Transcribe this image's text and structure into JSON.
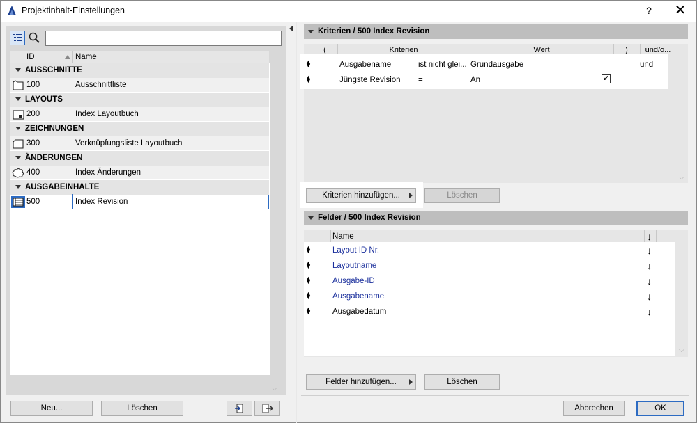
{
  "window": {
    "title": "Projektinhalt-Einstellungen",
    "help_label": "?",
    "close_label": "✕"
  },
  "left": {
    "search_placeholder": "",
    "search_value": "",
    "columns": {
      "id": "ID",
      "name": "Name"
    },
    "groups": [
      {
        "label": "AUSSCHNITTE",
        "items": [
          {
            "id": "100",
            "name": "Ausschnittliste",
            "icon": "view-list-icon"
          }
        ]
      },
      {
        "label": "LAYOUTS",
        "items": [
          {
            "id": "200",
            "name": "Index Layoutbuch",
            "icon": "layout-book-icon"
          }
        ]
      },
      {
        "label": "ZEICHNUNGEN",
        "items": [
          {
            "id": "300",
            "name": "Verknüpfungsliste Layoutbuch",
            "icon": "drawing-icon"
          }
        ]
      },
      {
        "label": "ÄNDERUNGEN",
        "items": [
          {
            "id": "400",
            "name": "Index Änderungen",
            "icon": "cloud-change-icon"
          }
        ]
      },
      {
        "label": "AUSGABEINHALTE",
        "items": [
          {
            "id": "500",
            "name": "Index Revision",
            "icon": "issue-content-icon",
            "selected": true
          }
        ]
      }
    ],
    "buttons": {
      "new": "Neu...",
      "delete": "Löschen"
    }
  },
  "criteria": {
    "title": "Kriterien / 500 Index Revision",
    "columns": {
      "open": "(",
      "criteria": "Kriterien",
      "value": "Wert",
      "close": ")",
      "andor": "und/o..."
    },
    "rows": [
      {
        "criterion": "Ausgabename",
        "operator": "ist nicht glei...",
        "value": "Grundausgabe",
        "andor": "und",
        "checked": false
      },
      {
        "criterion": "Jüngste Revision",
        "operator": "=",
        "value": "An",
        "andor": "",
        "checked": true
      }
    ],
    "add_button": "Kriterien hinzufügen...",
    "delete_button": "Löschen"
  },
  "fields": {
    "title": "Felder / 500 Index Revision",
    "column_name": "Name",
    "rows": [
      {
        "name": "Layout ID Nr.",
        "linked": true
      },
      {
        "name": "Layoutname",
        "linked": true
      },
      {
        "name": "Ausgabe-ID",
        "linked": true
      },
      {
        "name": "Ausgabename",
        "linked": true
      },
      {
        "name": "Ausgabedatum",
        "linked": false
      }
    ],
    "sort_glyph": "↓",
    "add_button": "Felder hinzufügen...",
    "delete_button": "Löschen"
  },
  "footer": {
    "cancel": "Abbrechen",
    "ok": "OK"
  },
  "colors": {
    "accent": "#2d6bc2",
    "link_text": "#1a2f9c",
    "section_header": "#bebebe"
  }
}
